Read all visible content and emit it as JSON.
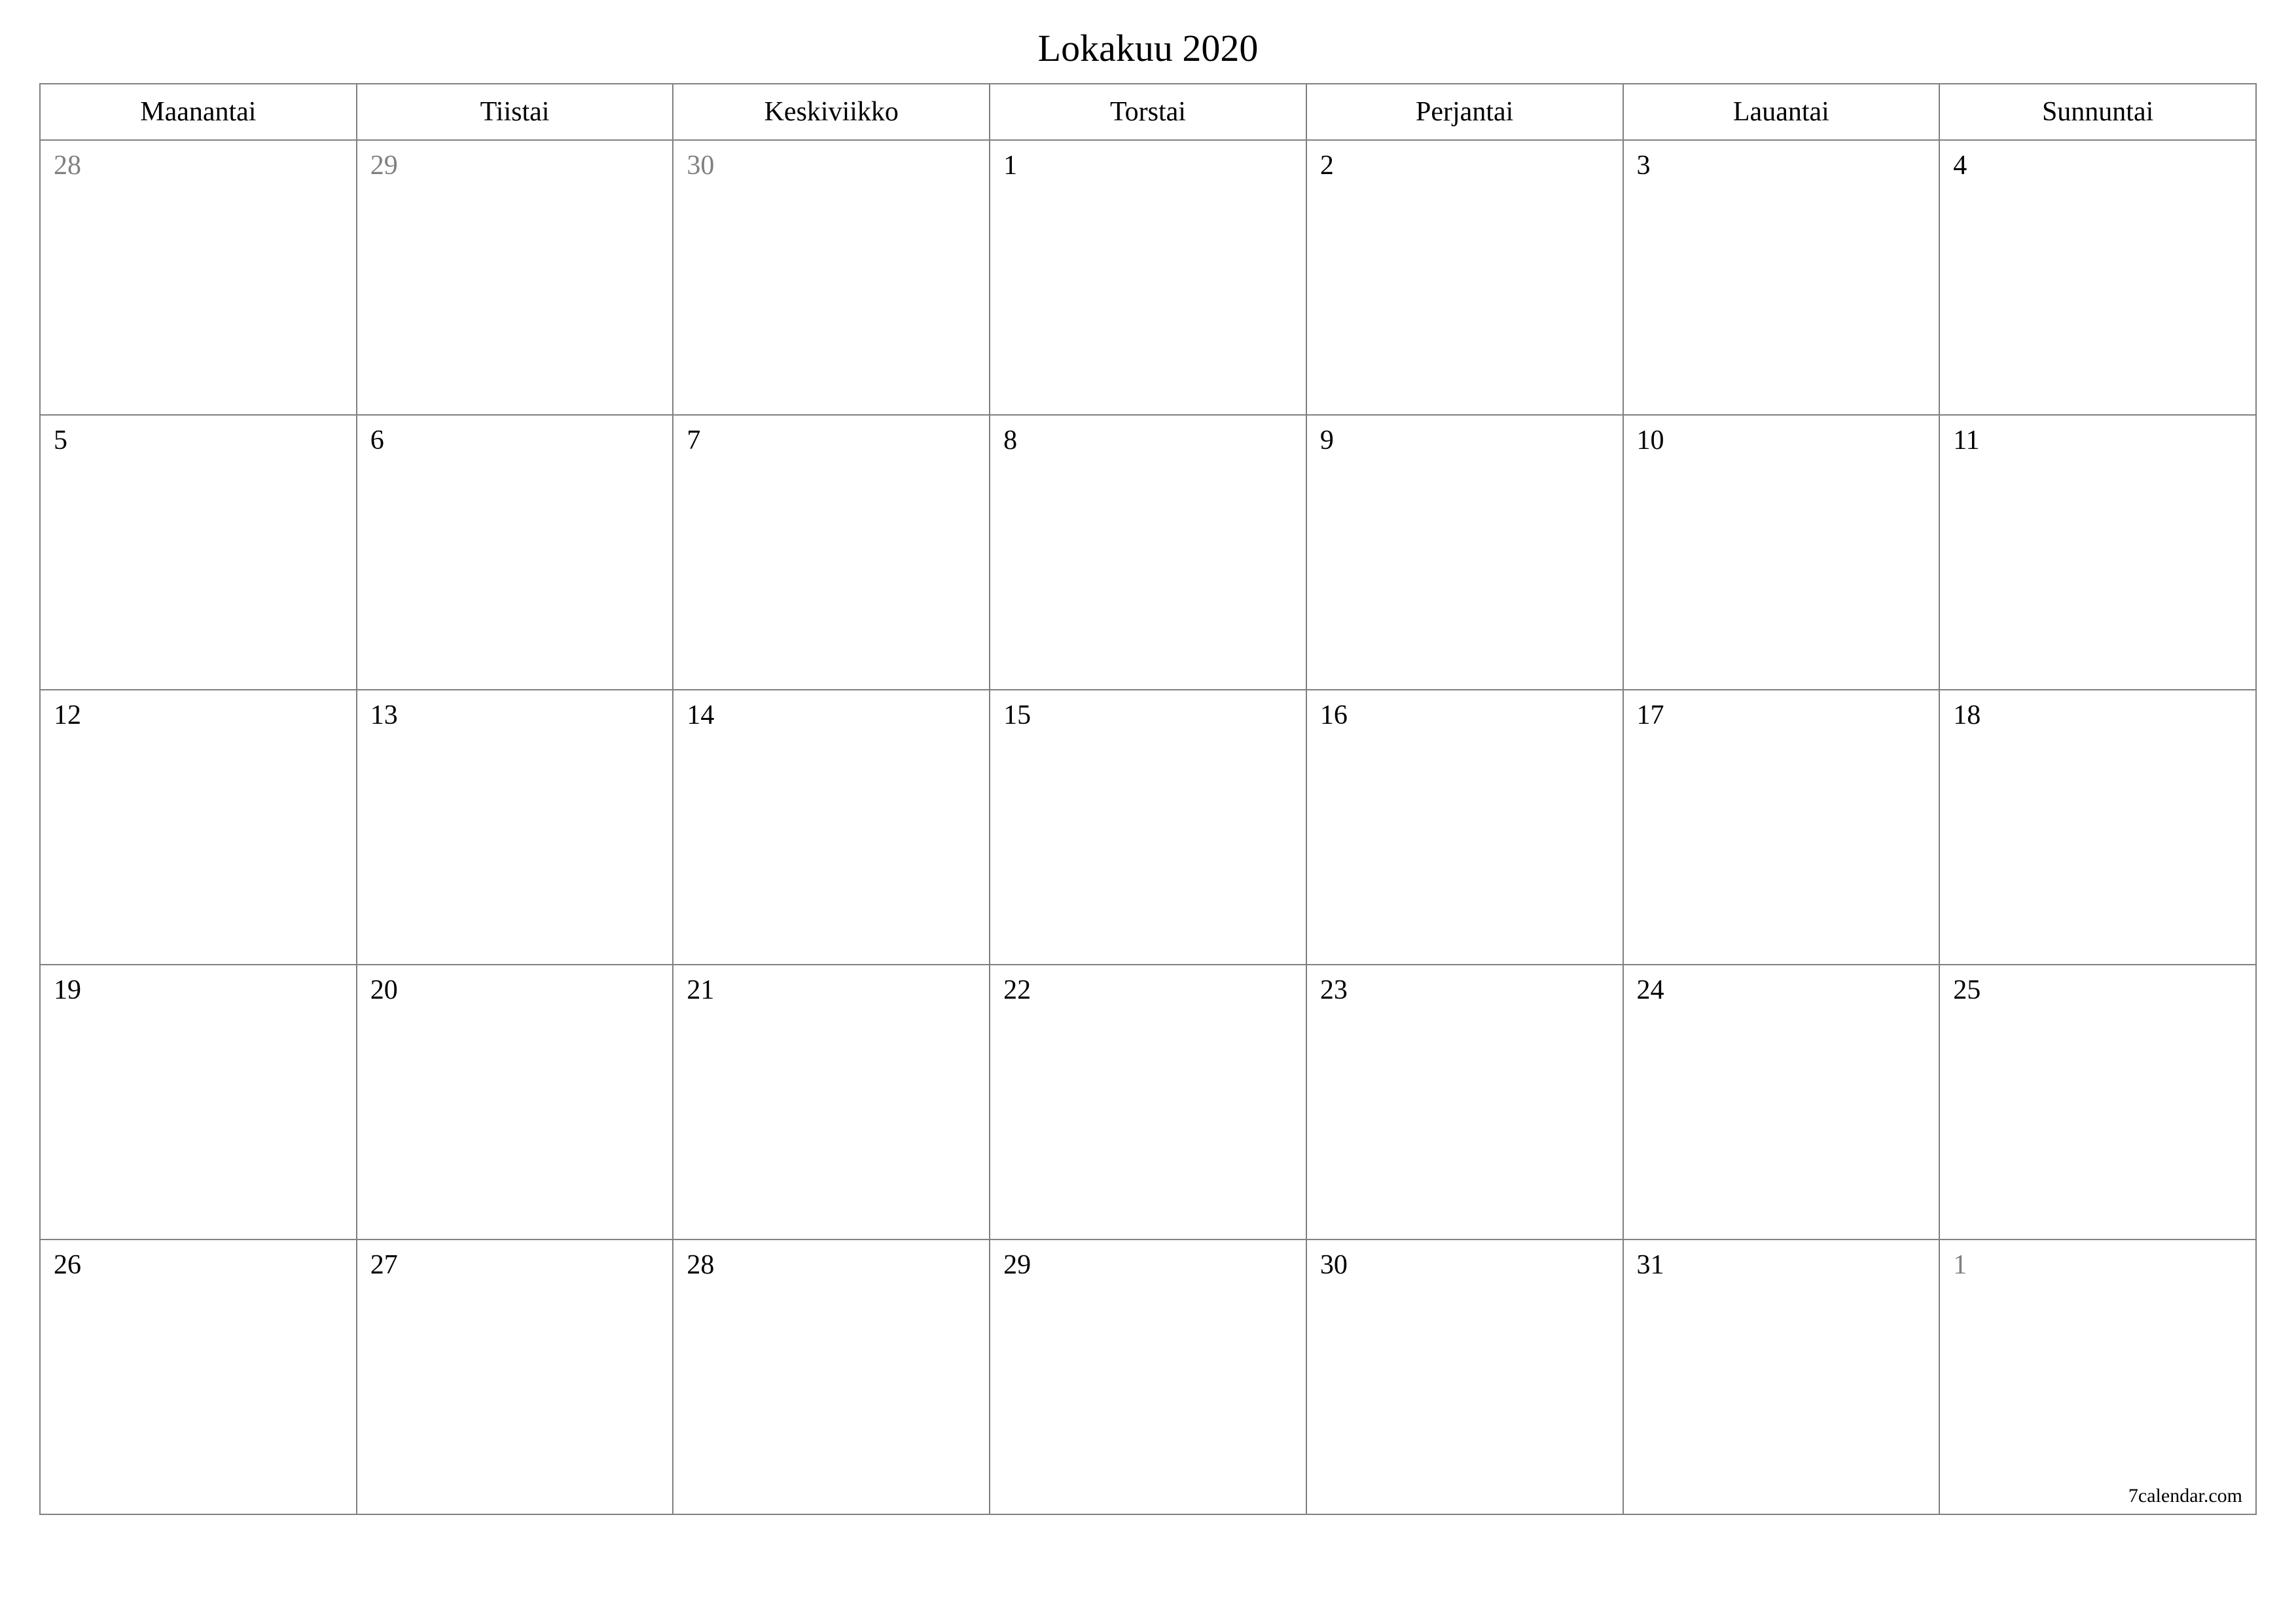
{
  "title": "Lokakuu 2020",
  "weekdays": [
    "Maanantai",
    "Tiistai",
    "Keskiviikko",
    "Torstai",
    "Perjantai",
    "Lauantai",
    "Sunnuntai"
  ],
  "weeks": [
    [
      {
        "n": "28",
        "out": true
      },
      {
        "n": "29",
        "out": true
      },
      {
        "n": "30",
        "out": true
      },
      {
        "n": "1",
        "out": false
      },
      {
        "n": "2",
        "out": false
      },
      {
        "n": "3",
        "out": false
      },
      {
        "n": "4",
        "out": false
      }
    ],
    [
      {
        "n": "5",
        "out": false
      },
      {
        "n": "6",
        "out": false
      },
      {
        "n": "7",
        "out": false
      },
      {
        "n": "8",
        "out": false
      },
      {
        "n": "9",
        "out": false
      },
      {
        "n": "10",
        "out": false
      },
      {
        "n": "11",
        "out": false
      }
    ],
    [
      {
        "n": "12",
        "out": false
      },
      {
        "n": "13",
        "out": false
      },
      {
        "n": "14",
        "out": false
      },
      {
        "n": "15",
        "out": false
      },
      {
        "n": "16",
        "out": false
      },
      {
        "n": "17",
        "out": false
      },
      {
        "n": "18",
        "out": false
      }
    ],
    [
      {
        "n": "19",
        "out": false
      },
      {
        "n": "20",
        "out": false
      },
      {
        "n": "21",
        "out": false
      },
      {
        "n": "22",
        "out": false
      },
      {
        "n": "23",
        "out": false
      },
      {
        "n": "24",
        "out": false
      },
      {
        "n": "25",
        "out": false
      }
    ],
    [
      {
        "n": "26",
        "out": false
      },
      {
        "n": "27",
        "out": false
      },
      {
        "n": "28",
        "out": false
      },
      {
        "n": "29",
        "out": false
      },
      {
        "n": "30",
        "out": false
      },
      {
        "n": "31",
        "out": false
      },
      {
        "n": "1",
        "out": true
      }
    ]
  ],
  "footer": "7calendar.com"
}
